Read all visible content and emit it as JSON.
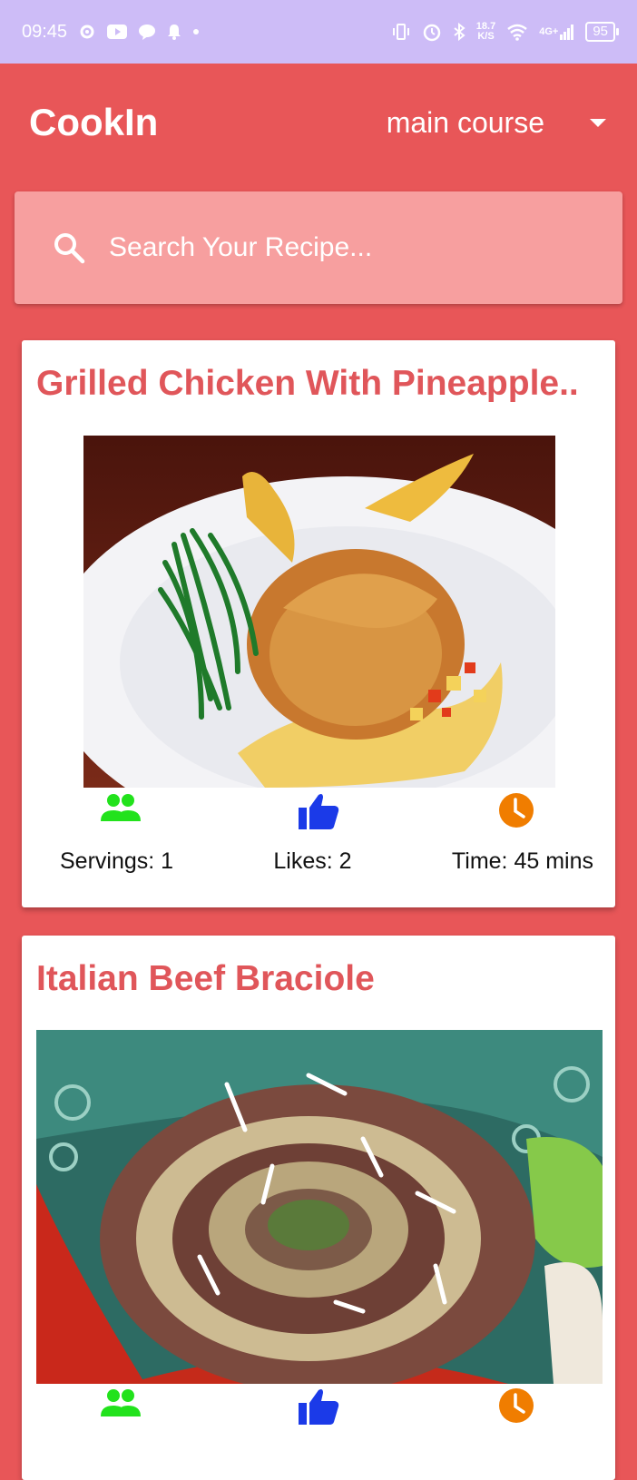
{
  "status_bar": {
    "time": "09:45",
    "speed_value": "18.7",
    "speed_unit": "K/S",
    "network": "4G+",
    "battery": "95"
  },
  "app": {
    "title": "CookIn",
    "category_selected": "main course"
  },
  "search": {
    "placeholder": "Search Your Recipe..."
  },
  "recipes": [
    {
      "title": "Grilled Chicken With Pineapple..",
      "servings": "Servings: 1",
      "likes": "Likes: 2",
      "time": "Time: 45 mins"
    },
    {
      "title": "Italian Beef Braciole"
    }
  ],
  "colors": {
    "primary": "#e85658",
    "status_bar": "#cdbcf7",
    "search_bg": "#f79f9f",
    "title_text": "#e0565a",
    "servings_icon": "#22e21c",
    "likes_icon": "#1b3ae8",
    "time_icon": "#f07d00"
  },
  "icons": {
    "servings": "people-icon",
    "likes": "thumbs-up-icon",
    "time": "clock-icon",
    "search": "search-icon",
    "dropdown": "caret-down-icon"
  }
}
